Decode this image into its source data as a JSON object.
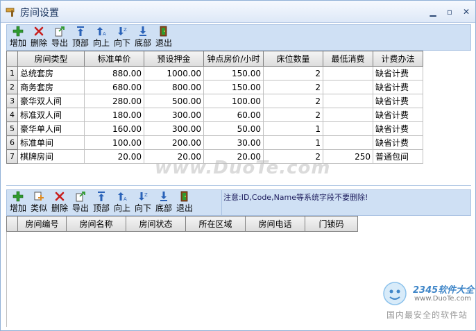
{
  "window": {
    "title": "房间设置",
    "minimize_glyph": "▁",
    "maximize_glyph": "▫",
    "close_glyph": "✕"
  },
  "toolbar_top": {
    "buttons": [
      {
        "label": "增加",
        "icon": "add-icon"
      },
      {
        "label": "删除",
        "icon": "delete-icon"
      },
      {
        "label": "导出",
        "icon": "export-icon"
      },
      {
        "label": "顶部",
        "icon": "move-top-icon"
      },
      {
        "label": "向上",
        "icon": "move-up-icon"
      },
      {
        "label": "向下",
        "icon": "move-down-icon"
      },
      {
        "label": "底部",
        "icon": "move-bottom-icon"
      },
      {
        "label": "退出",
        "icon": "exit-icon"
      }
    ]
  },
  "room_types": {
    "columns": [
      "房间类型",
      "标准单价",
      "预设押金",
      "钟点房价/小时",
      "床位数量",
      "最低消费",
      "计费办法"
    ],
    "rows": [
      {
        "num": "1",
        "type": "总统套房",
        "price": "880.00",
        "deposit": "1000.00",
        "hourly": "150.00",
        "beds": "2",
        "min_spend": "",
        "billing": "缺省计费"
      },
      {
        "num": "2",
        "type": "商务套房",
        "price": "680.00",
        "deposit": "800.00",
        "hourly": "150.00",
        "beds": "2",
        "min_spend": "",
        "billing": "缺省计费"
      },
      {
        "num": "3",
        "type": "豪华双人间",
        "price": "280.00",
        "deposit": "500.00",
        "hourly": "100.00",
        "beds": "2",
        "min_spend": "",
        "billing": "缺省计费"
      },
      {
        "num": "4",
        "type": "标准双人间",
        "price": "180.00",
        "deposit": "300.00",
        "hourly": "60.00",
        "beds": "2",
        "min_spend": "",
        "billing": "缺省计费"
      },
      {
        "num": "5",
        "type": "豪华单人间",
        "price": "160.00",
        "deposit": "300.00",
        "hourly": "50.00",
        "beds": "1",
        "min_spend": "",
        "billing": "缺省计费"
      },
      {
        "num": "6",
        "type": "标准单间",
        "price": "100.00",
        "deposit": "200.00",
        "hourly": "30.00",
        "beds": "1",
        "min_spend": "",
        "billing": "缺省计费"
      },
      {
        "num": "7",
        "type": "棋牌房间",
        "price": "20.00",
        "deposit": "20.00",
        "hourly": "20.00",
        "beds": "2",
        "min_spend": "250",
        "billing": "普通包间"
      }
    ]
  },
  "toolbar_bottom": {
    "buttons": [
      {
        "label": "增加",
        "icon": "add-icon"
      },
      {
        "label": "类似",
        "icon": "copy-similar-icon"
      },
      {
        "label": "删除",
        "icon": "delete-icon"
      },
      {
        "label": "导出",
        "icon": "export-icon"
      },
      {
        "label": "顶部",
        "icon": "move-top-icon"
      },
      {
        "label": "向上",
        "icon": "move-up-icon"
      },
      {
        "label": "向下",
        "icon": "move-down-icon"
      },
      {
        "label": "底部",
        "icon": "move-bottom-icon"
      },
      {
        "label": "退出",
        "icon": "exit-icon"
      }
    ],
    "notice": "注意:ID,Code,Name等系统字段不要删除!"
  },
  "rooms": {
    "columns": [
      "房间编号",
      "房间名称",
      "房间状态",
      "所在区域",
      "房间电话",
      "门锁码"
    ]
  },
  "watermarks": {
    "duote": "www.DuoTe.com",
    "brand": "2345软件大全",
    "url": "www.DuoTe.com",
    "slogan": "国内最安全的软件站"
  },
  "colors": {
    "toolbar_bg": "#cfe0f4",
    "title_bg": "#dde8f7",
    "grid_border": "#808080"
  }
}
